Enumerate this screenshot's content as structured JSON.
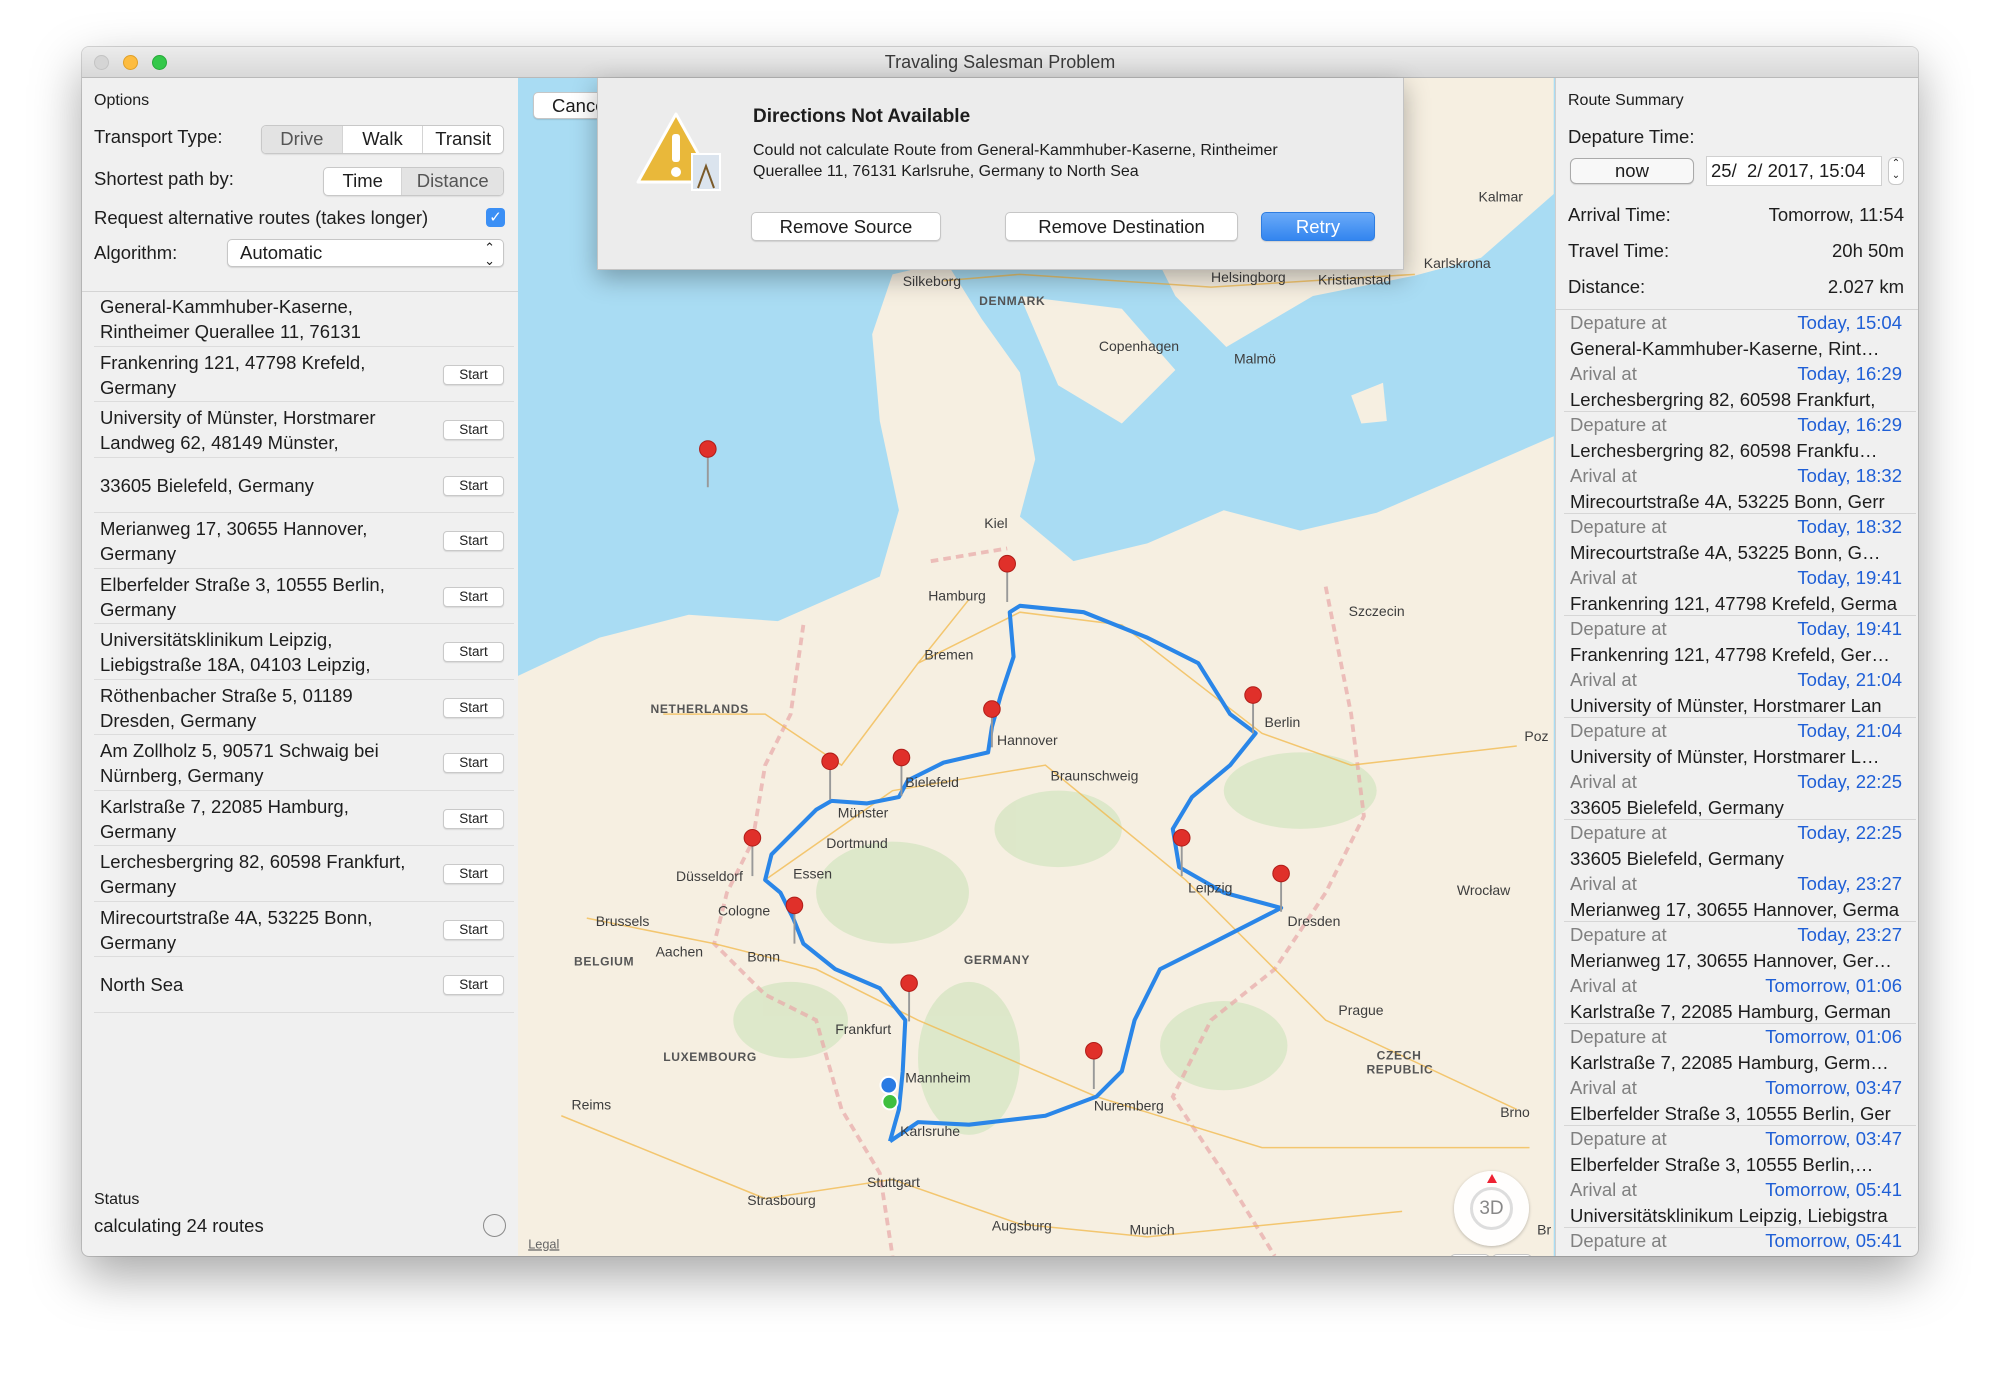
{
  "window": {
    "title": "Travaling Salesman Problem"
  },
  "options": {
    "header": "Options",
    "transport_label": "Transport Type:",
    "transport_options": [
      "Drive",
      "Walk",
      "Transit"
    ],
    "transport_selected": "Drive",
    "shortest_label": "Shortest path by:",
    "shortest_options": [
      "Time",
      "Distance"
    ],
    "shortest_selected": "Distance",
    "alt_routes_label": "Request alternative routes (takes longer)",
    "alt_routes_checked": true,
    "algorithm_label": "Algorithm:",
    "algorithm_value": "Automatic",
    "start_label": "Start",
    "locations": [
      {
        "text": "General-Kammhuber-Kaserne, Rintheimer Querallee 11, 76131",
        "start": false
      },
      {
        "text": "Frankenring 121, 47798 Krefeld, Germany",
        "start": true
      },
      {
        "text": "University of Münster, Horstmarer Landweg 62, 48149 Münster,",
        "start": true
      },
      {
        "text": "33605 Bielefeld, Germany",
        "start": true
      },
      {
        "text": "Merianweg 17, 30655 Hannover, Germany",
        "start": true
      },
      {
        "text": "Elberfelder Straße 3, 10555 Berlin, Germany",
        "start": true
      },
      {
        "text": "Universitätsklinikum Leipzig, Liebigstraße 18A, 04103 Leipzig,",
        "start": true
      },
      {
        "text": "Röthenbacher Straße 5, 01189 Dresden, Germany",
        "start": true
      },
      {
        "text": "Am Zollholz 5, 90571 Schwaig bei Nürnberg, Germany",
        "start": true
      },
      {
        "text": "Karlstraße 7, 22085 Hamburg, Germany",
        "start": true
      },
      {
        "text": "Lerchesbergring 82, 60598 Frankfurt, Germany",
        "start": true
      },
      {
        "text": "Mirecourtstraße 4A, 53225 Bonn, Germany",
        "start": true
      },
      {
        "text": "North Sea",
        "start": true
      }
    ],
    "status_label": "Status",
    "status_text": "calculating 24 routes"
  },
  "map": {
    "cancel_label": "Cancel",
    "legal": "Legal",
    "compass_label": "3D",
    "zoom_out": "−",
    "zoom_in": "+",
    "route_color": "#2a86e8",
    "pin_color": "#e0302a",
    "labels": [
      "Silkeborg",
      "DENMARK",
      "Helsingborg",
      "Kristianstad",
      "Karlskrona",
      "Kalmar",
      "Copenhagen",
      "Malmö",
      "Kiel",
      "Hamburg",
      "Szczecin",
      "Bremen",
      "NETHERLANDS",
      "Berlin",
      "Hannover",
      "Braunschweig",
      "Bielefeld",
      "Münster",
      "Dortmund",
      "Essen",
      "Düsseldorf",
      "Leipzig",
      "Wrocław",
      "Cologne",
      "Dresden",
      "Brussels",
      "Aachen",
      "BELGIUM",
      "Bonn",
      "GERMANY",
      "Prague",
      "Frankfurt",
      "LUXEMBOURG",
      "CZECH",
      "REPUBLIC",
      "Mannheim",
      "Reims",
      "Nuremberg",
      "Brno",
      "Karlsruhe",
      "Stuttgart",
      "Strasbourg",
      "Augsburg",
      "Munich",
      "Poz",
      "Br"
    ]
  },
  "dialog": {
    "icon": "warning-icon",
    "title": "Directions Not Available",
    "message": "Could not calculate Route from General-Kammhuber-Kaserne, Rintheimer Querallee 11, 76131 Karlsruhe, Germany to North Sea",
    "buttons": {
      "remove_source": "Remove Source",
      "remove_destination": "Remove Destination",
      "retry": "Retry"
    },
    "accent": "#3d8ef0"
  },
  "summary": {
    "header": "Route Summary",
    "departure_label": "Depature Time:",
    "now_label": "now",
    "departure_value": "25/  2/ 2017, 15:04",
    "arrival_label": "Arrival Time:",
    "arrival_value": "Tomorrow, 11:54",
    "travel_label": "Travel Time:",
    "travel_value": "20h 50m",
    "distance_label": "Distance:",
    "distance_value": "2.027 km",
    "dep_word": "Depature at",
    "arr_word": "Arival at",
    "legs": [
      {
        "dep_time": "Today, 15:04",
        "from": "General-Kammhuber-Kaserne, Rint…",
        "arr_time": "Today, 16:29",
        "to": "Lerchesbergring 82, 60598 Frankfurt,"
      },
      {
        "dep_time": "Today, 16:29",
        "from": "Lerchesbergring 82, 60598 Frankfu…",
        "arr_time": "Today, 18:32",
        "to": "Mirecourtstraße 4A, 53225 Bonn, Gerr"
      },
      {
        "dep_time": "Today, 18:32",
        "from": "Mirecourtstraße 4A, 53225 Bonn, G…",
        "arr_time": "Today, 19:41",
        "to": "Frankenring 121, 47798 Krefeld, Germa"
      },
      {
        "dep_time": "Today, 19:41",
        "from": "Frankenring 121, 47798 Krefeld, Ger…",
        "arr_time": "Today, 21:04",
        "to": "University of Münster, Horstmarer Lan"
      },
      {
        "dep_time": "Today, 21:04",
        "from": "University of Münster, Horstmarer L…",
        "arr_time": "Today, 22:25",
        "to": "33605 Bielefeld, Germany"
      },
      {
        "dep_time": "Today, 22:25",
        "from": "33605 Bielefeld, Germany",
        "arr_time": "Today, 23:27",
        "to": "Merianweg 17, 30655 Hannover, Germa"
      },
      {
        "dep_time": "Today, 23:27",
        "from": "Merianweg 17, 30655 Hannover, Ger…",
        "arr_time": "Tomorrow, 01:06",
        "to": "Karlstraße 7, 22085 Hamburg, German"
      },
      {
        "dep_time": "Tomorrow, 01:06",
        "from": "Karlstraße 7, 22085 Hamburg, Germ…",
        "arr_time": "Tomorrow, 03:47",
        "to": "Elberfelder Straße 3, 10555 Berlin, Ger"
      },
      {
        "dep_time": "Tomorrow, 03:47",
        "from": "Elberfelder Straße 3, 10555 Berlin,…",
        "arr_time": "Tomorrow, 05:41",
        "to": "Universitätsklinikum Leipzig, Liebigstra"
      },
      {
        "dep_time": "Tomorrow, 05:41"
      }
    ]
  }
}
